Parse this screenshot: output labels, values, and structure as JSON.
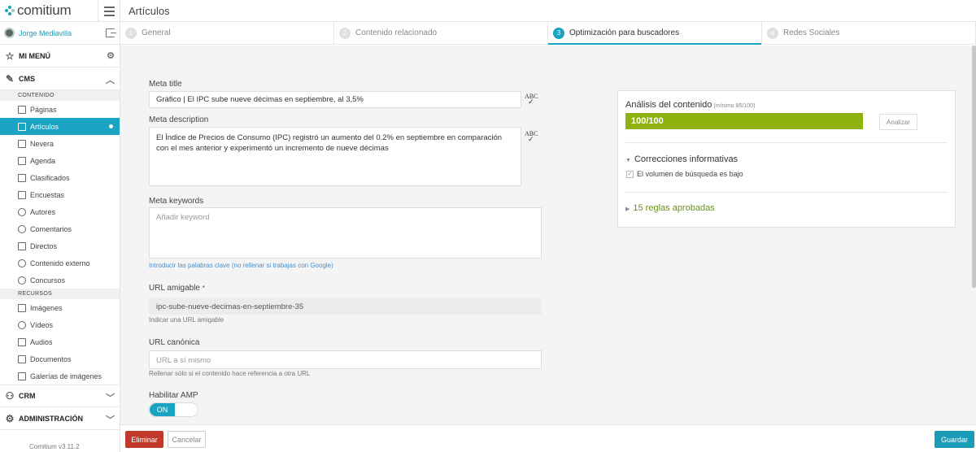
{
  "app": {
    "logo": "comitium",
    "version": "Comitium v3.11.2"
  },
  "user": {
    "name": "Jorge Mediavilla"
  },
  "sidebar": {
    "my_menu": "MI MENÚ",
    "cms": "CMS",
    "content_section": "CONTENIDO",
    "content_items": [
      {
        "label": "Páginas"
      },
      {
        "label": "Artículos"
      },
      {
        "label": "Nevera"
      },
      {
        "label": "Agenda"
      },
      {
        "label": "Clasificados"
      },
      {
        "label": "Encuestas"
      },
      {
        "label": "Autores"
      },
      {
        "label": "Comentarios"
      },
      {
        "label": "Directos"
      },
      {
        "label": "Contenido externo"
      },
      {
        "label": "Concursos"
      }
    ],
    "resources_section": "RECURSOS",
    "resource_items": [
      {
        "label": "Imágenes"
      },
      {
        "label": "Vídeos"
      },
      {
        "label": "Audios"
      },
      {
        "label": "Documentos"
      },
      {
        "label": "Galerías de imágenes"
      }
    ],
    "crm": "CRM",
    "admin": "ADMINISTRACIÓN"
  },
  "header": {
    "title": "Artículos"
  },
  "steps": [
    {
      "num": "1",
      "label": "General"
    },
    {
      "num": "2",
      "label": "Contenido relacionado"
    },
    {
      "num": "3",
      "label": "Optimización para buscadores"
    },
    {
      "num": "4",
      "label": "Redes Sociales"
    }
  ],
  "form": {
    "meta_title_label": "Meta title",
    "meta_title_value": "Gráfico | El IPC sube nueve décimas en septiembre, al 3,5%",
    "meta_description_label": "Meta description",
    "meta_description_value": "El Índice de Precios de Consumo (IPC) registró un aumento del 0.2% en septiembre en comparación con el mes anterior y experimentó un incremento de nueve décimas",
    "meta_keywords_label": "Meta keywords",
    "meta_keywords_placeholder": "Añadir keyword",
    "meta_keywords_help": "Introducir las palabras clave (no rellenar si trabajas con Google)",
    "url_label": "URL amigable",
    "url_required": "*",
    "url_value": "ipc-sube-nueve-decimas-en-septiembre-35",
    "url_help": "Indicar una URL amigable",
    "canonical_label": "URL canónica",
    "canonical_placeholder": "URL a sí mismo",
    "canonical_help": "Rellenar sólo si el contenido hace referencia a otra URL",
    "amp_label": "Habilitar AMP",
    "amp_state": "ON",
    "spell_icon_text": "ABC"
  },
  "analysis": {
    "title": "Análisis del contenido",
    "minimum": "(mínimo 85/100)",
    "score_text": "100/100",
    "score_fraction": 1.0,
    "score_color": "#8fb20f",
    "analyze_button": "Analizar",
    "corrections_title": "Correcciones informativas",
    "correction_items": [
      "El volumen de búsqueda es bajo"
    ],
    "approved_rules": "15 reglas aprobadas"
  },
  "footer": {
    "delete": "Eliminar",
    "cancel": "Cancelar",
    "save": "Guardar"
  },
  "colors": {
    "accent": "#1aa3c2",
    "danger": "#c0392b",
    "approved": "#6a8f1e"
  }
}
